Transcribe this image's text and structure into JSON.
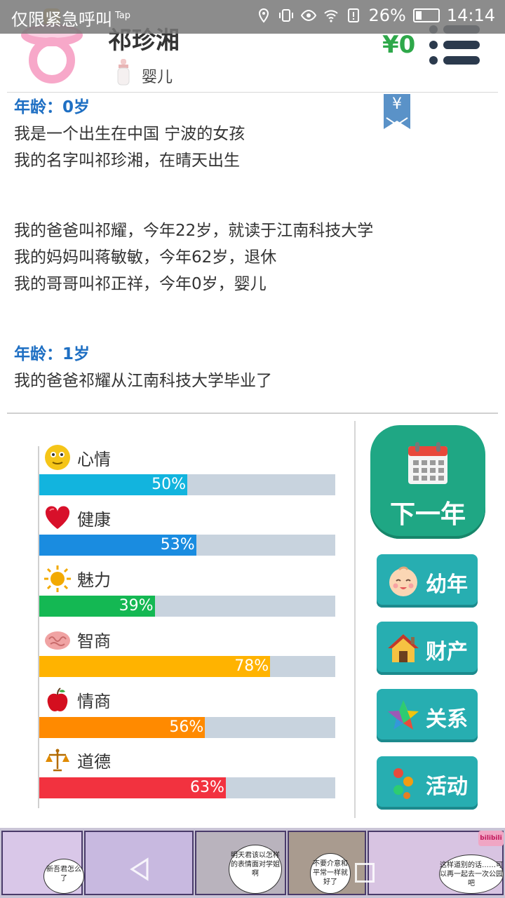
{
  "status_bar": {
    "left_text": "仅限紧急呼叫",
    "tap_text": "Tap",
    "battery": "26%",
    "time": "14:14"
  },
  "header": {
    "name": "祁珍湘",
    "stage": "婴儿",
    "money": "¥0",
    "icons": [
      "pacifier-icon",
      "baby-bottle-icon",
      "menu-icon"
    ]
  },
  "log": [
    {
      "kind": "age",
      "text": "年龄：0岁"
    },
    {
      "kind": "text",
      "text": "我是一个出生在中国 宁波的女孩"
    },
    {
      "kind": "text",
      "text": "我的名字叫祁珍湘，在晴天出生"
    },
    {
      "kind": "gap"
    },
    {
      "kind": "text",
      "text": "我的爸爸叫祁耀，今年22岁，就读于江南科技大学"
    },
    {
      "kind": "text",
      "text": "我的妈妈叫蒋敏敏，今年62岁，退休"
    },
    {
      "kind": "text",
      "text": "我的哥哥叫祁正祥，今年0岁，婴儿"
    },
    {
      "kind": "gap"
    },
    {
      "kind": "age",
      "text": "年龄：1岁"
    },
    {
      "kind": "text",
      "text": "我的爸爸祁耀从江南科技大学毕业了"
    }
  ],
  "yen_tag_label": "¥",
  "stats": [
    {
      "label": "心情",
      "percent": 50,
      "percent_text": "50%",
      "color": "#12b4de",
      "icon": "smiley-icon"
    },
    {
      "label": "健康",
      "percent": 53,
      "percent_text": "53%",
      "color": "#1a8ce0",
      "icon": "heart-icon"
    },
    {
      "label": "魅力",
      "percent": 39,
      "percent_text": "39%",
      "color": "#14b853",
      "icon": "sun-icon"
    },
    {
      "label": "智商",
      "percent": 78,
      "percent_text": "78%",
      "color": "#ffb300",
      "icon": "brain-icon"
    },
    {
      "label": "情商",
      "percent": 56,
      "percent_text": "56%",
      "color": "#ff8a00",
      "icon": "apple-icon"
    },
    {
      "label": "道德",
      "percent": 63,
      "percent_text": "63%",
      "color": "#f2323f",
      "icon": "scales-icon"
    }
  ],
  "actions": {
    "next_year": "下一年",
    "childhood": "幼年",
    "assets": "财产",
    "relations": "关系",
    "activities": "活动"
  },
  "ad": {
    "bubbles": [
      "新吾君怎么了",
      "明天君该以怎样的表情面对学姐啊",
      "不要介意和平常一样就好了",
      "这样道别的话……可以再一起去一次公园吧"
    ],
    "logo": "bilibili"
  }
}
